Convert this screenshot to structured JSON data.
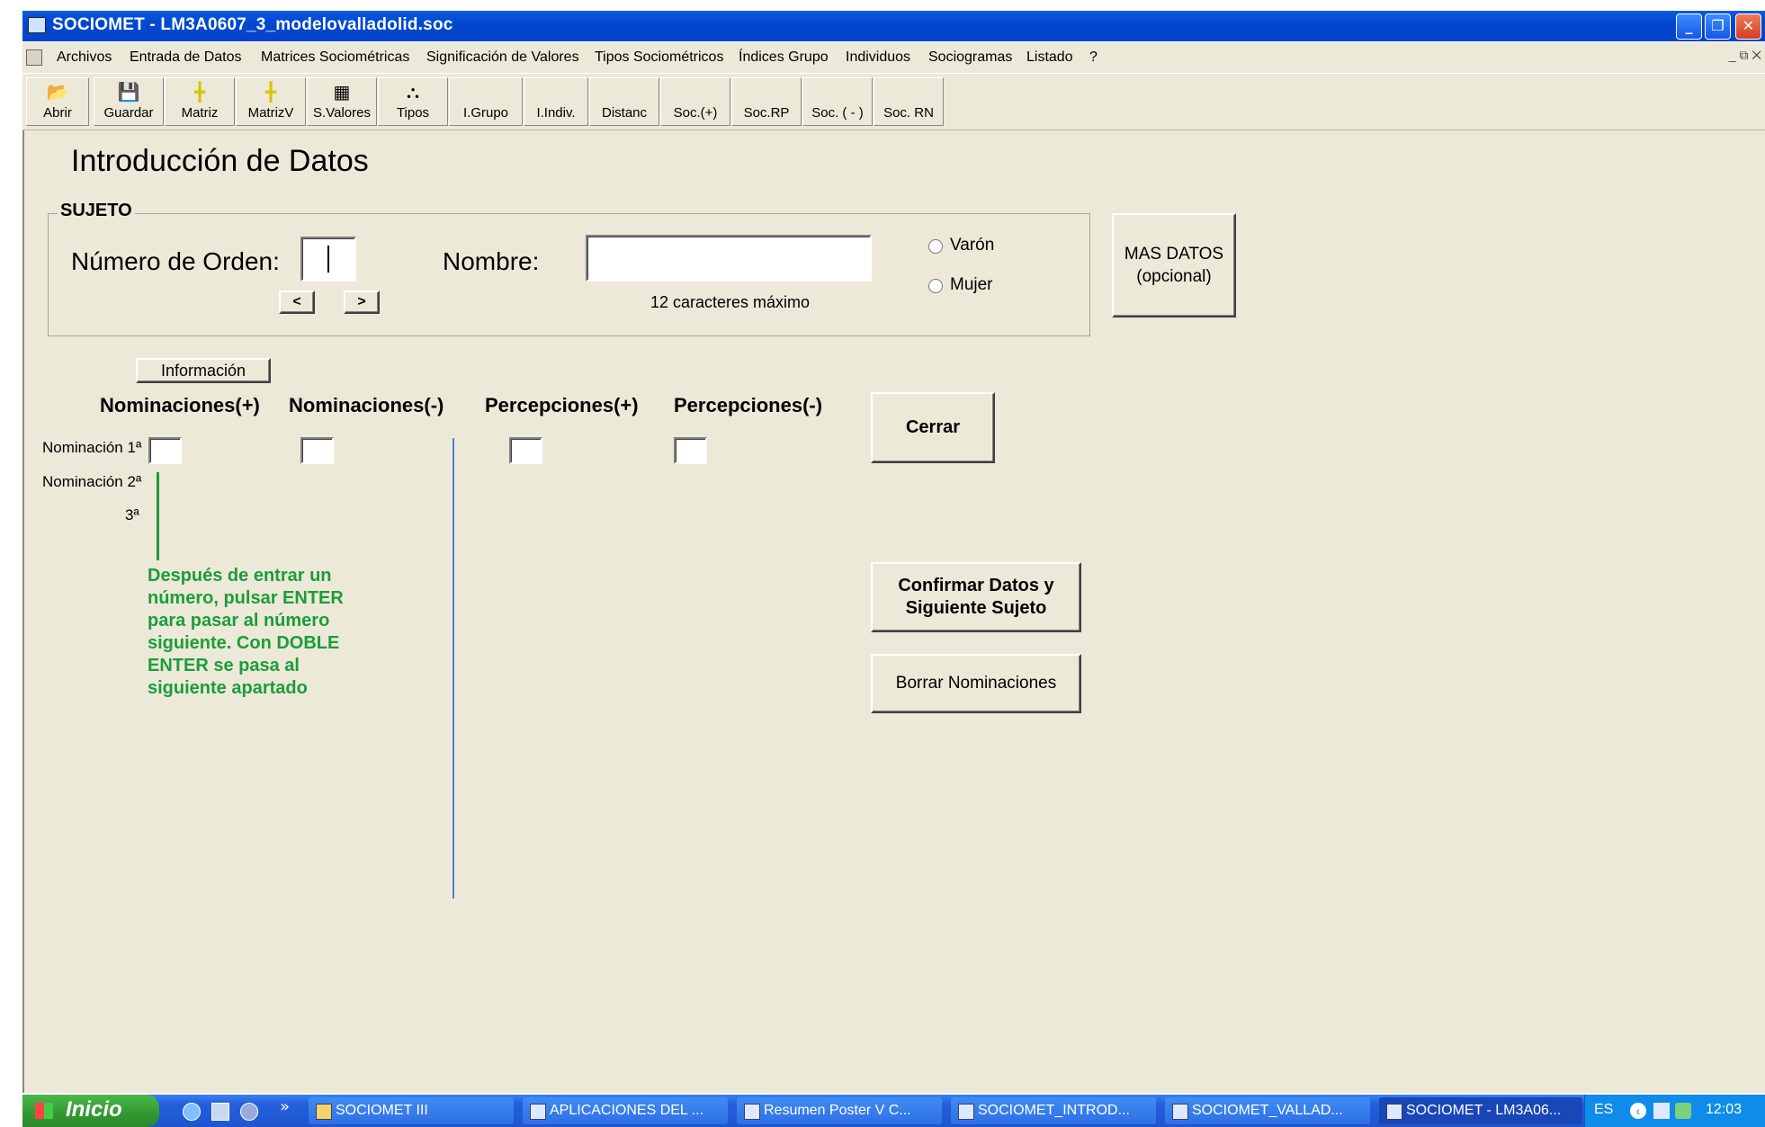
{
  "window": {
    "title": "SOCIOMET - LM3A0607_3_modelovalladolid.soc",
    "min": "_",
    "restore": "❐",
    "close": "✕"
  },
  "menu": {
    "items": [
      "Archivos",
      "Entrada de Datos",
      "Matrices Sociométricas",
      "Significación de Valores",
      "Tipos Sociométricos",
      "Índices Grupo",
      "Individuos",
      "Sociogramas",
      "Listado",
      "?"
    ],
    "mdi_controls": "_ ⧉ ✕"
  },
  "toolbar": {
    "buttons": [
      "Abrir",
      "Guardar",
      "Matriz",
      "MatrizV",
      "S.Valores",
      "Tipos",
      "I.Grupo",
      "I.Indiv.",
      "Distanc",
      "Soc.(+)",
      "Soc.RP",
      "Soc. ( - )",
      "Soc. RN"
    ]
  },
  "form": {
    "title": "Introducción de Datos",
    "group_label": "SUJETO",
    "order_label": "Número de Orden:",
    "order_value": "",
    "prev": "<",
    "next": ">",
    "name_label": "Nombre:",
    "name_value": "",
    "name_hint": "12 caracteres máximo",
    "gender_male": "Varón",
    "gender_female": "Mujer",
    "more_data_1": "MAS DATOS",
    "more_data_2": "(opcional)",
    "info_button": "Información",
    "col_nom_pos": "Nominaciones(+)",
    "col_nom_neg": "Nominaciones(-)",
    "col_per_pos": "Percepciones(+)",
    "col_per_neg": "Percepciones(-)",
    "row1": "Nominación 1ª",
    "row2": "Nominación 2ª",
    "row3": "3ª",
    "close_button": "Cerrar",
    "confirm_1": "Confirmar Datos y",
    "confirm_2": "Siguiente Sujeto",
    "clear_button": "Borrar Nominaciones",
    "hint_lines": [
      "Después de entrar un",
      "número, pulsar ENTER",
      "para pasar al número",
      "siguiente. Con DOBLE",
      "ENTER se pasa al",
      "siguiente apartado"
    ]
  },
  "taskbar": {
    "start": "Inicio",
    "more": "»",
    "tasks": [
      "SOCIOMET III",
      "APLICACIONES DEL ...",
      "Resumen Poster V C...",
      "SOCIOMET_INTROD...",
      "SOCIOMET_VALLAD...",
      "SOCIOMET - LM3A06..."
    ],
    "lang": "ES",
    "clock": "12:03"
  },
  "colors": {
    "titlebar": "#0247d0",
    "face": "#ece9d8",
    "hint_green": "#1b9d3a",
    "divider_blue": "#5b7fd6"
  }
}
